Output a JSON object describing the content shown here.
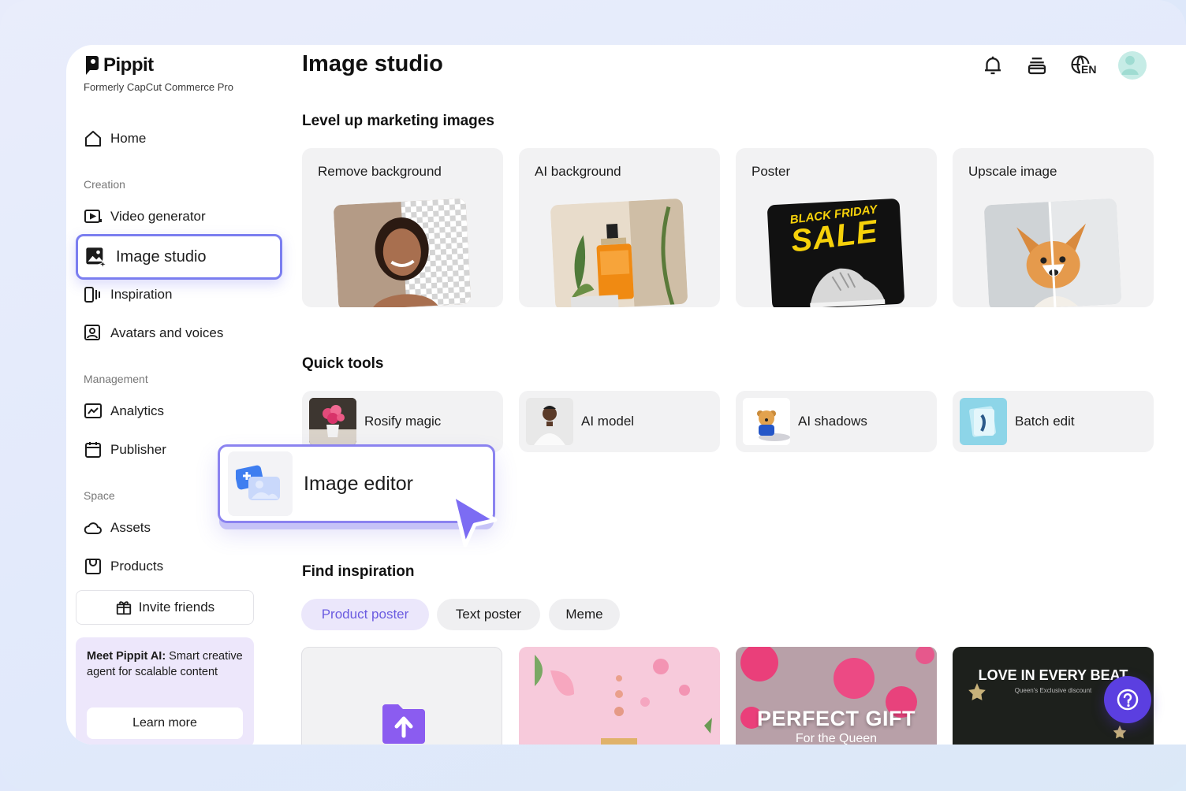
{
  "brand": {
    "name": "Pippit",
    "subtitle": "Formerly CapCut Commerce Pro"
  },
  "sidebar": {
    "home": "Home",
    "section_creation": "Creation",
    "video_generator": "Video generator",
    "image_studio": "Image studio",
    "inspiration": "Inspiration",
    "avatars": "Avatars and voices",
    "section_management": "Management",
    "analytics": "Analytics",
    "publisher": "Publisher",
    "section_space": "Space",
    "assets": "Assets",
    "products": "Products",
    "invite": "Invite friends",
    "promo_bold": "Meet Pippit AI:",
    "promo_text": " Smart creative agent for scalable content",
    "learn_more": "Learn more"
  },
  "header": {
    "title": "Image studio",
    "language": "EN"
  },
  "marketing": {
    "title": "Level up marketing images",
    "cards": [
      {
        "label": "Remove background"
      },
      {
        "label": "AI background"
      },
      {
        "label": "Poster"
      },
      {
        "label": "Upscale image"
      }
    ],
    "poster_line1": "BLACK FRIDAY",
    "poster_line2": "SALE"
  },
  "quick_tools": {
    "title": "Quick tools",
    "items": [
      {
        "label": "Rosify magic"
      },
      {
        "label": "AI model"
      },
      {
        "label": "AI shadows"
      },
      {
        "label": "Batch edit"
      }
    ]
  },
  "editor_popup": {
    "label": "Image editor"
  },
  "inspiration": {
    "title": "Find inspiration",
    "filters": [
      {
        "label": "Product poster",
        "active": true
      },
      {
        "label": "Text poster",
        "active": false
      },
      {
        "label": "Meme",
        "active": false
      }
    ],
    "card3_title": "PERFECT GIFT",
    "card3_sub": "For the Queen",
    "card4_title": "LOVE IN EVERY BEAT",
    "card4_sub": "Queen's Exclusive discount"
  },
  "colors": {
    "accent": "#7b7ef0",
    "help_button": "#5b3fe0",
    "active_pill_text": "#6a5be0"
  }
}
